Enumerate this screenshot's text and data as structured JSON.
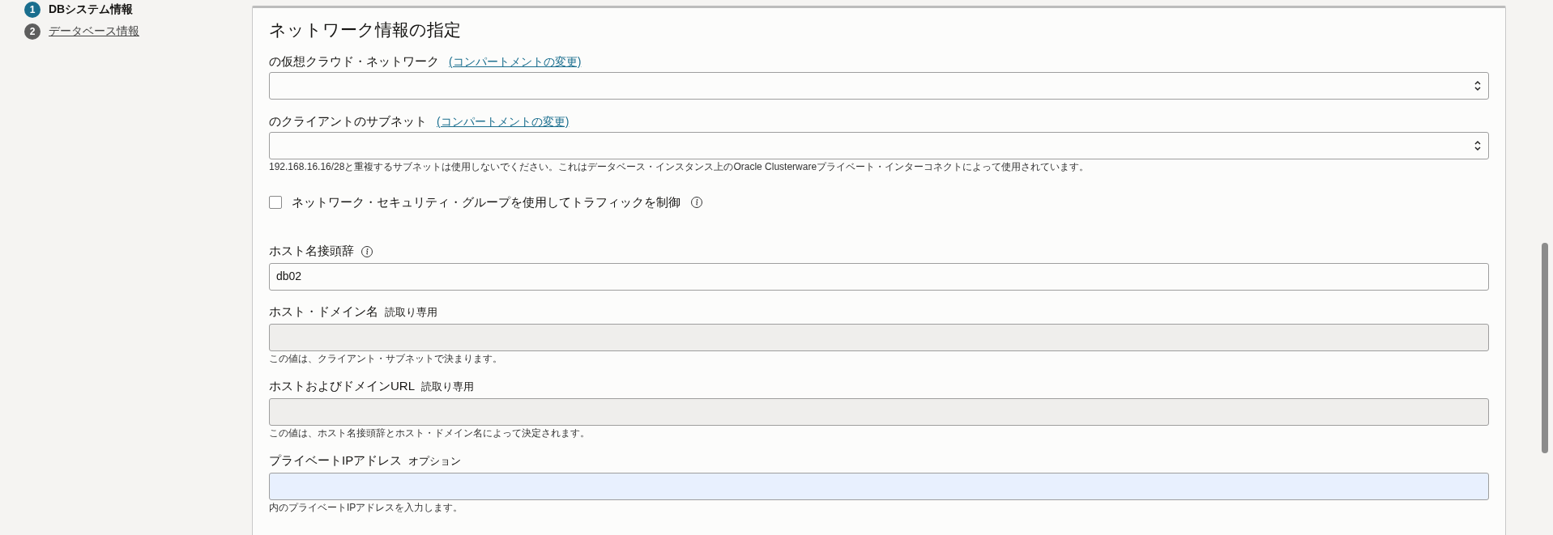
{
  "steps": [
    {
      "number": "1",
      "label": "DBシステム情報",
      "selected": true
    },
    {
      "number": "2",
      "label": "データベース情報",
      "selected": false
    }
  ],
  "section": {
    "title": "ネットワーク情報の指定",
    "fields": [
      {
        "kind": "select",
        "label": "の仮想クラウド・ネットワーク",
        "link": "(コンパートメントの変更)"
      },
      {
        "kind": "select",
        "label": "のクライアントのサブネット",
        "link": "(コンパートメントの変更)",
        "help": "192.168.16.16/28と重複するサブネットは使用しないでください。これはデータベース・インスタンス上のOracle Clusterwareプライベート・インターコネクトによって使用されています。"
      },
      {
        "kind": "checkbox",
        "label": "ネットワーク・セキュリティ・グループを使用してトラフィックを制御",
        "checked": false,
        "info": true
      },
      {
        "kind": "text",
        "label": "ホスト名接頭辞",
        "info": true,
        "value": "db02",
        "highlighted": false
      },
      {
        "kind": "readonly",
        "label": "ホスト・ドメイン名",
        "tag": "読取り専用",
        "help": "この値は、クライアント・サブネットで決まります。"
      },
      {
        "kind": "readonly",
        "label": "ホストおよびドメインURL",
        "tag": "読取り専用",
        "help": "この値は、ホスト名接頭辞とホスト・ドメイン名によって決定されます。"
      },
      {
        "kind": "text",
        "label": "プライベートIPアドレス",
        "tag": "オプション",
        "highlighted": true,
        "help": "内のプライベートIPアドレスを入力します。"
      }
    ]
  }
}
